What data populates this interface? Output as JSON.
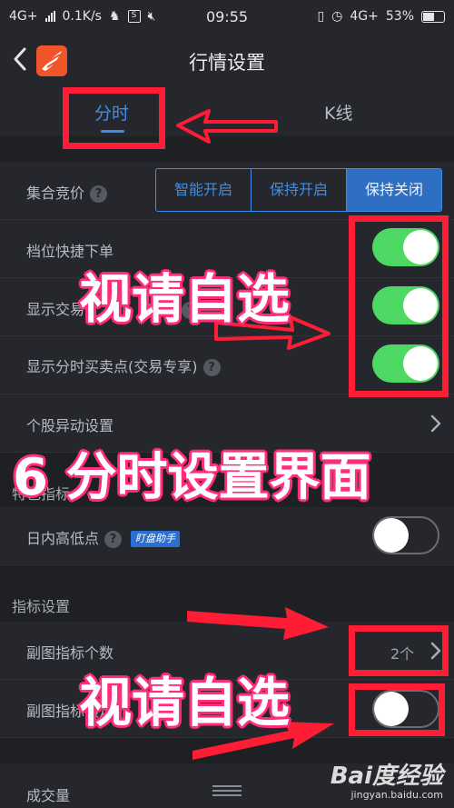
{
  "status_bar": {
    "network": "4G+",
    "speed": "0.1K/s",
    "time": "09:55",
    "network_right": "4G+",
    "battery": "53%"
  },
  "nav": {
    "title": "行情设置"
  },
  "tabs": [
    {
      "label": "分时",
      "active": true
    },
    {
      "label": "K线",
      "active": false
    }
  ],
  "settings": {
    "auction": {
      "label": "集合竞价",
      "options": [
        "智能开启",
        "保持开启",
        "保持关闭"
      ],
      "selected": "保持关闭"
    },
    "quick_order": {
      "label": "档位快捷下单",
      "enabled": true
    },
    "show_trade": {
      "label": "显示交易(交易专享)",
      "label_visible": "显示交易",
      "label_tail": "专享)",
      "enabled": true
    },
    "buy_sell_points": {
      "label": "显示分时买卖点(交易专享)",
      "enabled": true
    },
    "stock_anomaly": {
      "label": "个股异动设置"
    }
  },
  "special": {
    "section_label": "特色指标",
    "section_label_visible": "特色指标",
    "intraday_hl": {
      "label": "日内高低点",
      "badge": "盯盘助手",
      "enabled": false
    }
  },
  "indicator": {
    "section_label": "指标设置",
    "sub_count": {
      "label": "副图指标个数",
      "value": "2个"
    },
    "sub_lock": {
      "label": "副图指标锁定",
      "enabled": false
    }
  },
  "volume": {
    "label": "成交量"
  },
  "overlay": {
    "caption_top": "视请自选",
    "caption_mid": "6 分时设置界面",
    "caption_bottom": "视请自选"
  },
  "watermark": {
    "logo": "Bai度经验",
    "url": "jingyan.baidu.com"
  },
  "colors": {
    "accent_blue": "#3f8ee6",
    "toggle_on": "#4cd863",
    "annotation_red": "#ff1c35",
    "background": "#1f2024"
  },
  "icons": {
    "back": "chevron-left-icon",
    "help": "question-circle-icon",
    "arrow_right": "chevron-right-icon"
  }
}
